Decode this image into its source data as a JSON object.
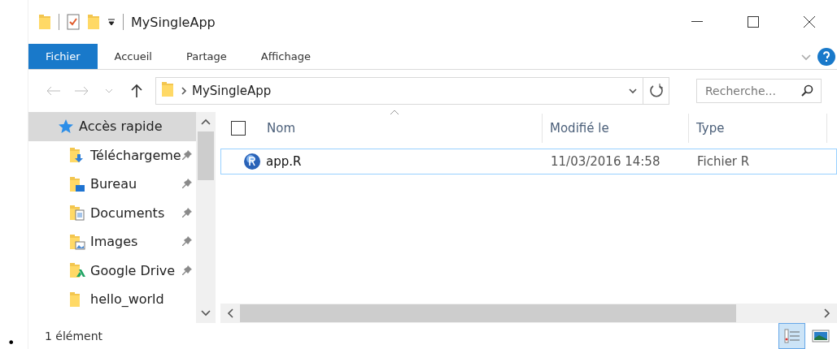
{
  "page_bullet": "•",
  "window": {
    "title": "MySingleApp"
  },
  "ribbon": {
    "tabs": [
      {
        "label": "Fichier",
        "kind": "file",
        "selected": false
      },
      {
        "label": "Accueil",
        "kind": "tab",
        "selected": false
      },
      {
        "label": "Partage",
        "kind": "tab",
        "selected": false
      },
      {
        "label": "Affichage",
        "kind": "tab",
        "selected": false
      }
    ]
  },
  "address_bar": {
    "path": [
      "MySingleApp"
    ],
    "back_disabled": true,
    "forward_disabled": true
  },
  "search": {
    "placeholder": "Recherche..."
  },
  "navigation": [
    {
      "label": "Accès rapide",
      "kind": "star",
      "selected": true,
      "children": [
        {
          "label": "Téléchargeme",
          "kind": "download",
          "pinned": true
        },
        {
          "label": "Bureau",
          "kind": "desktop",
          "pinned": true
        },
        {
          "label": "Documents",
          "kind": "documents",
          "pinned": true
        },
        {
          "label": "Images",
          "kind": "images",
          "pinned": true
        },
        {
          "label": "Google Drive",
          "kind": "drive",
          "pinned": true
        },
        {
          "label": "hello_world",
          "kind": "folder",
          "pinned": false
        }
      ]
    }
  ],
  "table": {
    "select_all": {
      "checked": false
    },
    "columns": [
      {
        "label": "Nom",
        "sorted": true
      },
      {
        "label": "Modifié le",
        "sorted": false
      },
      {
        "label": "Type",
        "sorted": false
      }
    ],
    "rows": [
      {
        "name": "app.R",
        "modified": "11/03/2016 14:58",
        "type": "Fichier R",
        "focused": true
      }
    ]
  },
  "status_bar": {
    "count": "1 élément",
    "views": [
      {
        "kind": "details",
        "selected": true
      },
      {
        "kind": "tiles",
        "selected": false
      }
    ]
  }
}
